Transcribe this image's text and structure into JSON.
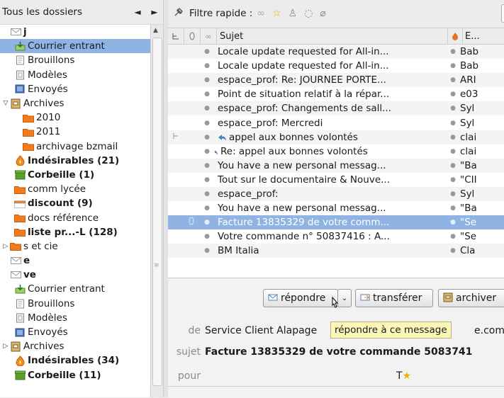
{
  "folder_pane": {
    "title": "Tous les dossiers",
    "nav_prev": "◄",
    "nav_next": "►",
    "folders": [
      {
        "label": "j",
        "bold": true,
        "indent": 0,
        "twisty": "",
        "icon": "account-icon"
      },
      {
        "label": "Courrier entrant",
        "bold": false,
        "indent": 1,
        "twisty": "",
        "icon": "inbox-icon",
        "selected": true
      },
      {
        "label": "Brouillons",
        "bold": false,
        "indent": 1,
        "twisty": "",
        "icon": "drafts-icon"
      },
      {
        "label": "Modèles",
        "bold": false,
        "indent": 1,
        "twisty": "",
        "icon": "templates-icon"
      },
      {
        "label": "Envoyés",
        "bold": false,
        "indent": 1,
        "twisty": "",
        "icon": "sent-icon"
      },
      {
        "label": "Archives",
        "bold": false,
        "indent": 0,
        "twisty": "▽",
        "icon": "archive-icon"
      },
      {
        "label": "2010",
        "bold": false,
        "indent": 3,
        "twisty": "",
        "icon": "folder-icon"
      },
      {
        "label": "2011",
        "bold": false,
        "indent": 3,
        "twisty": "",
        "icon": "folder-icon"
      },
      {
        "label": "archivage bzmail",
        "bold": false,
        "indent": 3,
        "twisty": "",
        "icon": "folder-icon"
      },
      {
        "label": "Indésirables (21)",
        "bold": true,
        "indent": 1,
        "twisty": "",
        "icon": "junk-icon"
      },
      {
        "label": "Corbeille (1)",
        "bold": true,
        "indent": 1,
        "twisty": "",
        "icon": "trash-icon"
      },
      {
        "label": "comm lycée",
        "bold": false,
        "indent": 1,
        "twisty": "",
        "icon": "folder-icon"
      },
      {
        "label": "discount (9)",
        "bold": true,
        "indent": 1,
        "twisty": "",
        "icon": "open-folder-icon"
      },
      {
        "label": "docs référence",
        "bold": false,
        "indent": 1,
        "twisty": "",
        "icon": "folder-icon"
      },
      {
        "label": "liste pr...-L (128)",
        "bold": true,
        "indent": 1,
        "twisty": "",
        "icon": "folder-icon"
      },
      {
        "label": "s et cie",
        "bold": false,
        "indent": 0,
        "twisty": "▷",
        "icon": "folder-icon"
      },
      {
        "label": "e",
        "bold": true,
        "indent": 0,
        "twisty": "",
        "icon": "account-icon"
      },
      {
        "label": "ve",
        "bold": true,
        "indent": 0,
        "twisty": "",
        "icon": "account-icon"
      },
      {
        "label": "Courrier entrant",
        "bold": false,
        "indent": 1,
        "twisty": "",
        "icon": "inbox-icon"
      },
      {
        "label": "Brouillons",
        "bold": false,
        "indent": 1,
        "twisty": "",
        "icon": "drafts-icon"
      },
      {
        "label": "Modèles",
        "bold": false,
        "indent": 1,
        "twisty": "",
        "icon": "templates-icon"
      },
      {
        "label": "Envoyés",
        "bold": false,
        "indent": 1,
        "twisty": "",
        "icon": "sent-icon"
      },
      {
        "label": "Archives",
        "bold": false,
        "indent": 0,
        "twisty": "▷",
        "icon": "archive-icon"
      },
      {
        "label": "Indésirables (34)",
        "bold": true,
        "indent": 1,
        "twisty": "",
        "icon": "junk-icon"
      },
      {
        "label": "Corbeille (11)",
        "bold": true,
        "indent": 1,
        "twisty": "",
        "icon": "trash-icon"
      }
    ]
  },
  "quick_filter": {
    "label": "Filtre rapide :",
    "icons": [
      "link-icon",
      "star-icon",
      "contact-icon",
      "tag-icon",
      "attachment-icon"
    ]
  },
  "message_list": {
    "columns": {
      "subject": "Sujet",
      "sender": "E..."
    },
    "rows": [
      {
        "subject": "Locale update requested for All-in...",
        "sender": "Bab"
      },
      {
        "subject": "Locale update requested for All-in...",
        "sender": "Bab"
      },
      {
        "subject": "espace_prof: Re: JOURNEE PORTE...",
        "sender": "ARI"
      },
      {
        "subject": "Point de situation relatif à la répar...",
        "sender": "e03"
      },
      {
        "subject": "espace_prof: Changements de sall...",
        "sender": "Syl"
      },
      {
        "subject": "espace_prof: Mercredi",
        "sender": "Syl"
      },
      {
        "subject": "appel aux bonnes volontés",
        "sender": "clai",
        "thread_parent": true
      },
      {
        "subject": "Re: appel aux bonnes volontés",
        "sender": "clai",
        "reply": true
      },
      {
        "subject": "You have a new personal messag...",
        "sender": "\"Ba"
      },
      {
        "subject": "Tout sur le documentaire & Nouve...",
        "sender": "\"CII"
      },
      {
        "subject": "espace_prof:",
        "sender": "Syl"
      },
      {
        "subject": "You have a new personal messag...",
        "sender": "\"Ba"
      },
      {
        "subject": "Facture 13835329 de votre comm...",
        "sender": "\"Se",
        "selected": true,
        "attachment": true
      },
      {
        "subject": "Votre commande n° 50837416 : A...",
        "sender": "\"Se"
      },
      {
        "subject": "BM Italia",
        "sender": "Cla"
      }
    ]
  },
  "preview": {
    "reply_label": "répondre",
    "forward_label": "transférer",
    "archive_label": "archiver",
    "tooltip": "répondre à ce message",
    "from_key": "de",
    "from_value": "Service Client Alapage",
    "from_suffix": "e.com>",
    "subject_key": "sujet",
    "subject_value": "Facture 13835329 de votre commande 5083741",
    "to_key": "pour",
    "to_value": "T"
  },
  "colors": {
    "selection": "#8fb4e3",
    "folder": "#f07c1e",
    "tooltip": "#fbf6b8"
  }
}
